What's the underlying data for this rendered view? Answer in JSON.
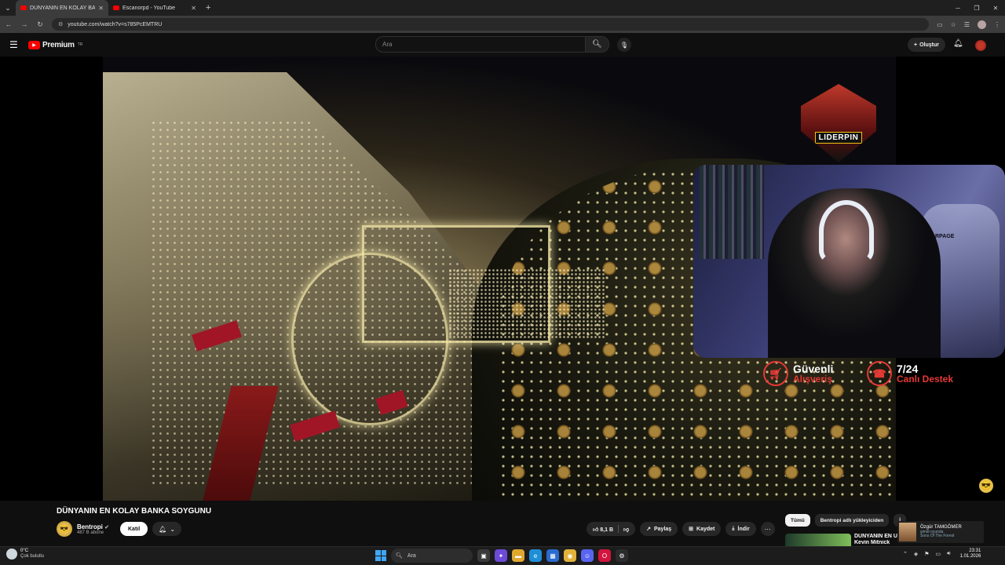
{
  "browser": {
    "tabs": [
      {
        "title": "DÜNYANIN EN KOLAY BANKA S",
        "active": true
      },
      {
        "title": "Escanorpd - YouTube",
        "active": false
      }
    ],
    "url": "youtube.com/watch?v=s785PcEMTRU"
  },
  "yt_header": {
    "brand": "Premium",
    "region": "TR",
    "search_placeholder": "Ara",
    "create_label": "Oluştur"
  },
  "overlay": {
    "brand_name": "LIDERPIN",
    "promo1_line1": "Güvenli",
    "promo1_line2": "Alışveriş",
    "promo2_line1": "7/24",
    "promo2_line2": "Canlı Destek",
    "chair_label": "RPAGE"
  },
  "video": {
    "title": "DÜNYANIN EN KOLAY BANKA SOYGUNU",
    "channel_name": "Bentropi",
    "subscribers": "487 B abone",
    "join_label": "Katıl",
    "likes": "8,1 B",
    "share_label": "Paylaş",
    "save_label": "Kaydet",
    "download_label": "İndir"
  },
  "sidebar": {
    "chips": [
      "Tümü",
      "Bentropi adlı yükleyiciden",
      "İ"
    ],
    "rec_title": "DÜNYANIN EN Ü",
    "rec_subtitle": "Kevin Mitnick"
  },
  "toast": {
    "name": "Özgür TAMGÖMER",
    "status": "şimdi oyunda",
    "game": "Sons Of The Forest"
  },
  "taskbar": {
    "temp": "0°C",
    "weather": "Çok bulutlu",
    "search_label": "Ara",
    "time": "23:31",
    "date": "1.01.2026"
  }
}
